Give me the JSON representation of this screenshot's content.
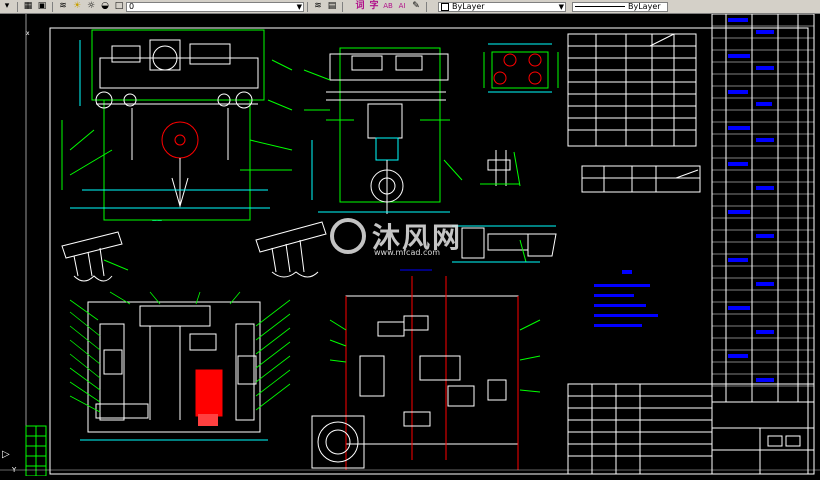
{
  "toolbar": {
    "layer_value": "0",
    "color_value": "ByLayer",
    "linetype_value": "ByLayer",
    "text_tools": [
      "词",
      "字",
      "AB",
      "AI"
    ]
  },
  "drawing": {
    "watermark_text": "沐风网",
    "watermark_url": "www.mfcad.com",
    "ucs_label": "Y",
    "corner_label": "x"
  },
  "colors": {
    "background": "#000000",
    "green": "#00ff00",
    "cyan": "#00ffff",
    "white": "#ffffff",
    "blue": "#0000ff",
    "red": "#ff0000",
    "yellow": "#ffff00"
  }
}
